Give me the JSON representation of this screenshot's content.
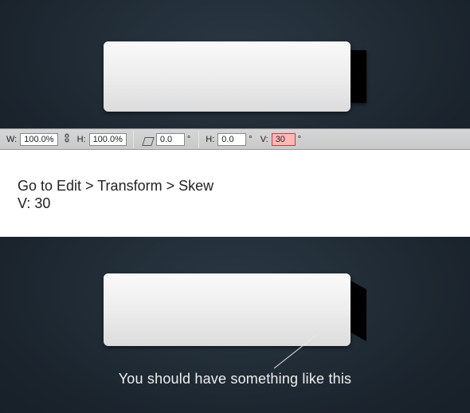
{
  "options_bar": {
    "w_label": "W:",
    "w_value": "100.0%",
    "h_label": "H:",
    "h_value": "100.0%",
    "rotate_value": "0.0",
    "skew_h_label": "H:",
    "skew_h_value": "0.0",
    "skew_v_label": "V:",
    "skew_v_value": "30",
    "degree": "°"
  },
  "instruction": {
    "line1": "Go to Edit > Transform > Skew",
    "line2": "V: 30"
  },
  "caption": "You should have something like this"
}
